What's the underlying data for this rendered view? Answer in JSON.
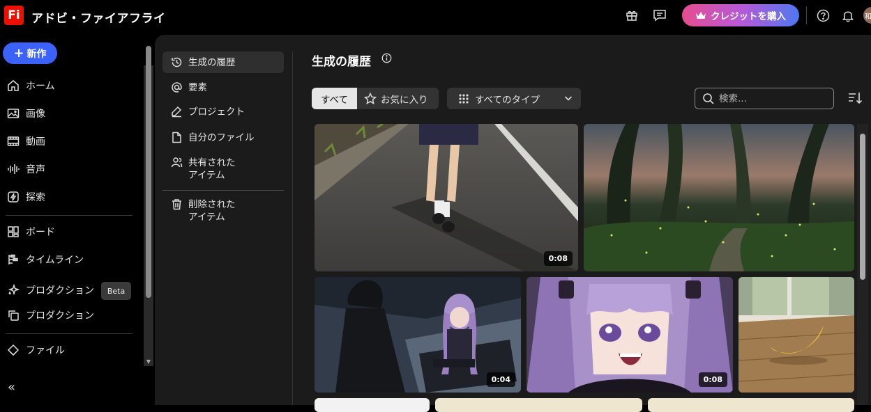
{
  "app": {
    "logo": "Fi",
    "title": "アドビ・ファイアフライ"
  },
  "topbar": {
    "credit_button": "クレジットを購入",
    "avatar_initial": "和",
    "icons": [
      "gift-icon",
      "chat-icon",
      "help-icon",
      "bell-icon"
    ]
  },
  "sidebar": {
    "new_button": "新作",
    "items": [
      {
        "label": "ホーム",
        "icon": "home-icon"
      },
      {
        "label": "画像",
        "icon": "image-icon"
      },
      {
        "label": "動画",
        "icon": "video-icon"
      },
      {
        "label": "音声",
        "icon": "audio-icon"
      },
      {
        "label": "探索",
        "icon": "explore-icon"
      },
      {
        "label": "ボード",
        "icon": "board-icon"
      },
      {
        "label": "タイムライン",
        "icon": "timeline-icon"
      },
      {
        "label": "プロダクション",
        "icon": "sparkle-icon"
      },
      {
        "label": "プロダクション",
        "icon": "copy-icon"
      },
      {
        "label": "ファイル",
        "icon": "files-icon"
      }
    ],
    "beta_badge": "Beta"
  },
  "subnav": {
    "items": [
      {
        "label": "生成の履歴",
        "icon": "history-icon"
      },
      {
        "label": "要素",
        "icon": "at-icon"
      },
      {
        "label": "プロジェクト",
        "icon": "project-icon"
      },
      {
        "label": "自分のファイル",
        "icon": "file-icon"
      },
      {
        "label": "共有された\nアイテム",
        "icon": "shared-icon"
      },
      {
        "label": "削除された\nアイテム",
        "icon": "trash-icon"
      }
    ]
  },
  "main": {
    "title": "生成の履歴",
    "filter_all": "すべて",
    "filter_favorites": "お気に入り",
    "type_dropdown": "すべてのタイプ",
    "search_placeholder": "検索..."
  },
  "gallery": [
    {
      "kind": "video",
      "duration": "0:08"
    },
    {
      "kind": "image"
    },
    {
      "kind": "video",
      "duration": "0:04"
    },
    {
      "kind": "video",
      "duration": "0:08"
    },
    {
      "kind": "image"
    }
  ],
  "colors": {
    "accent": "#3b63fb",
    "logo": "#eb1000",
    "panel": "#1b1b1b"
  }
}
